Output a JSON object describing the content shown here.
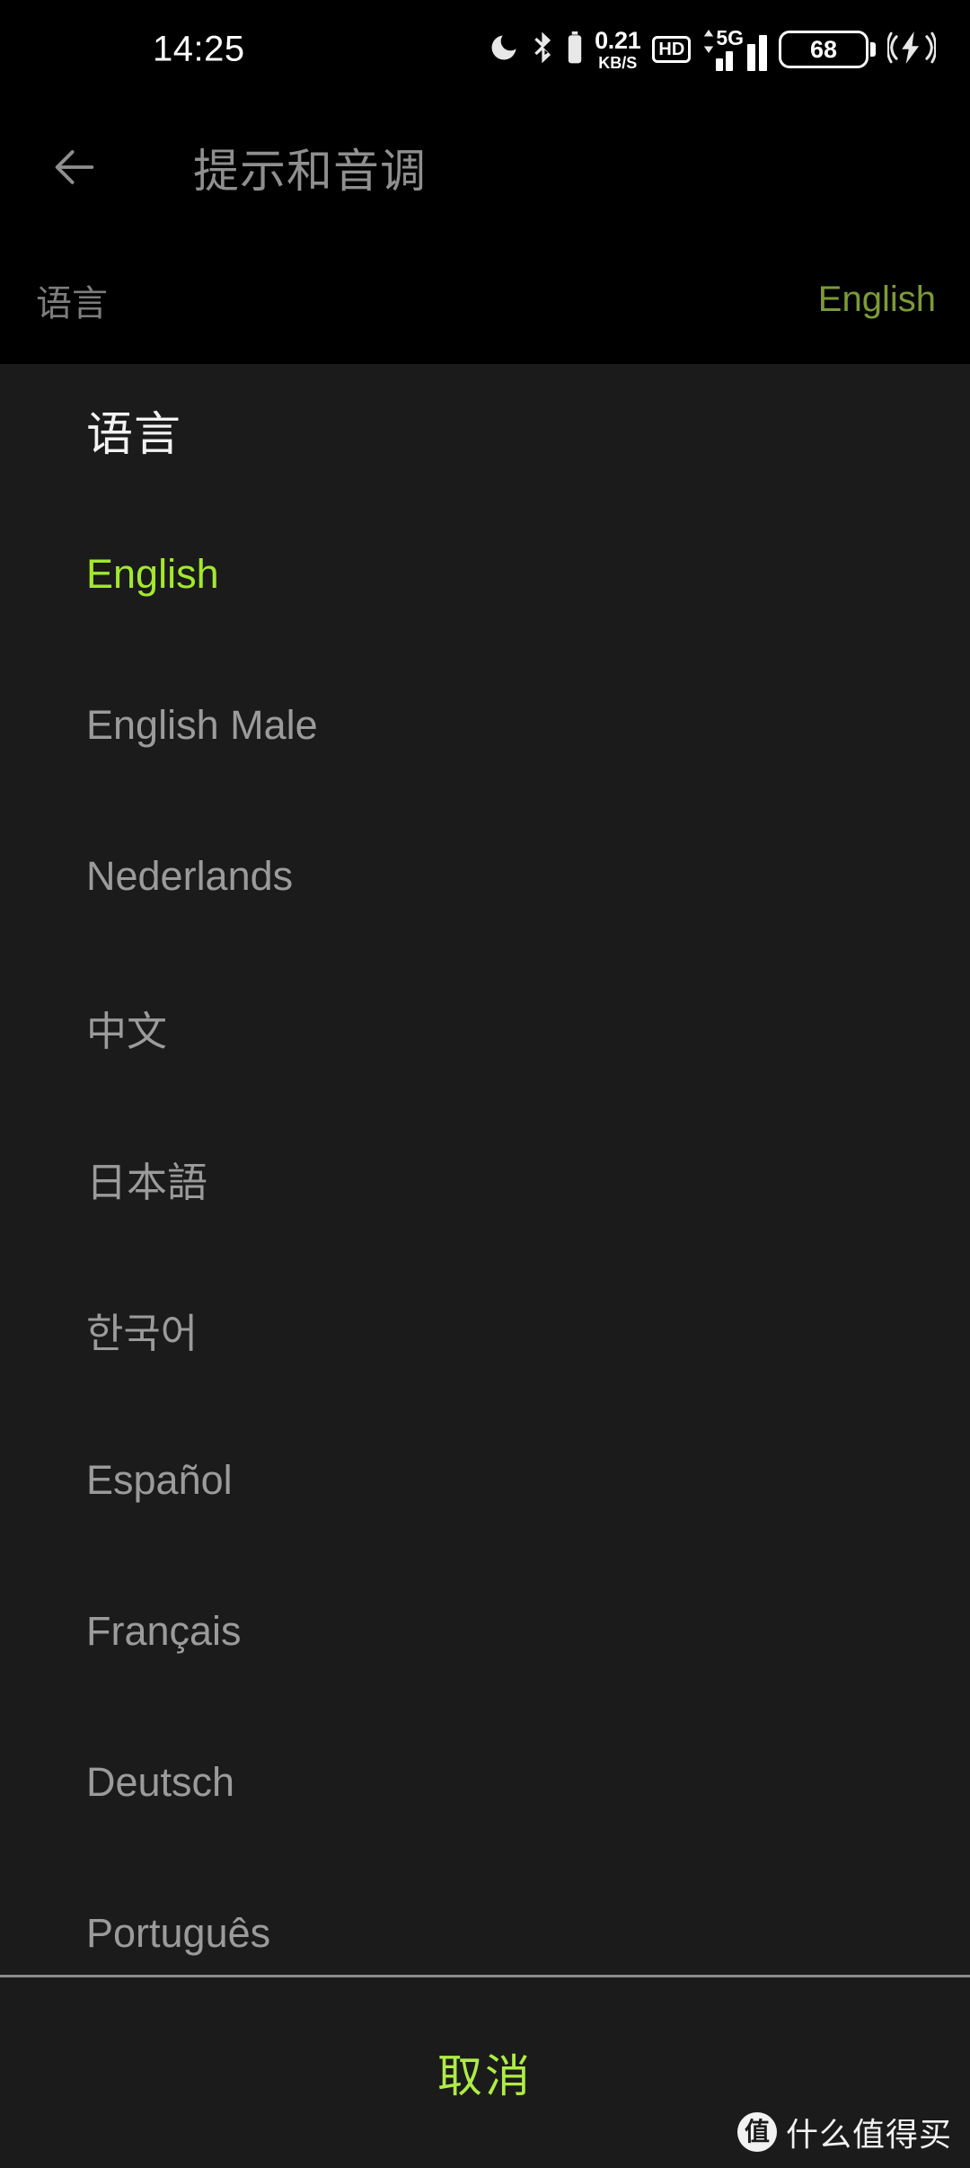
{
  "statusbar": {
    "clock": "14:25",
    "icons": {
      "dnd": "moon-icon",
      "bluetooth": "bluetooth-icon",
      "bluetooth_battery": "bluetooth-battery-icon",
      "hd": "HD",
      "network_type": "5G",
      "signal": "signal-bars-icon",
      "charging": "charging-wireless-icon"
    },
    "net_speed_value": "0.21",
    "net_speed_unit": "KB/S",
    "battery_percent": "68"
  },
  "appbar": {
    "back_icon": "arrow-left-icon",
    "title": "提示和音调"
  },
  "summary_row": {
    "label": "语言",
    "value": "English",
    "value_color": "#7c9b35"
  },
  "dialog": {
    "title": "语言",
    "selected_color": "#a4e82c",
    "options": [
      {
        "label": "English",
        "selected": true
      },
      {
        "label": "English Male",
        "selected": false
      },
      {
        "label": "Nederlands",
        "selected": false
      },
      {
        "label": "中文",
        "selected": false
      },
      {
        "label": "日本語",
        "selected": false
      },
      {
        "label": "한국어",
        "selected": false
      },
      {
        "label": "Español",
        "selected": false
      },
      {
        "label": "Français",
        "selected": false
      },
      {
        "label": "Deutsch",
        "selected": false
      },
      {
        "label": "Português",
        "selected": false
      }
    ],
    "cancel_label": "取消"
  },
  "watermark": {
    "badge": "值",
    "text": "什么值得买"
  }
}
